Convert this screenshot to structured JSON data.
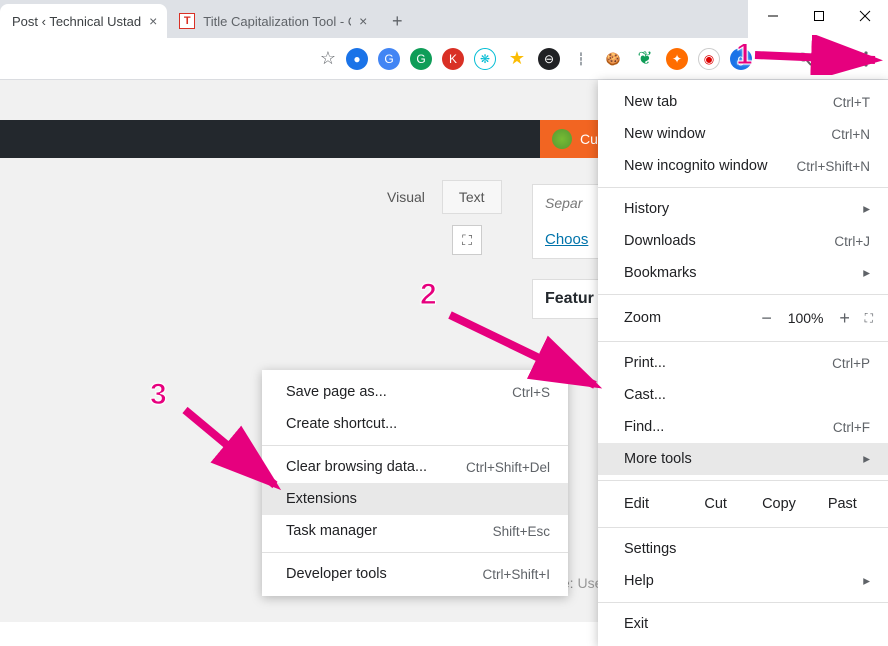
{
  "tabs": [
    {
      "title": "Post ‹ Technical Ustad",
      "favicon_letter": "",
      "favicon_bg": "#000"
    },
    {
      "title": "Title Capitalization Tool - Capitali",
      "favicon_letter": "T",
      "favicon_bg": "#fff"
    }
  ],
  "page": {
    "orange_button": "Cu",
    "editor_tab_visual": "Visual",
    "editor_tab_text": "Text",
    "separate_text": "Separ",
    "choose_link": "Choos",
    "featured_heading": "Featur",
    "notice_label": "Notice:",
    "notice_text": " Use only with those post templates:"
  },
  "chrome_menu": {
    "new_tab": {
      "label": "New tab",
      "shortcut": "Ctrl+T"
    },
    "new_window": {
      "label": "New window",
      "shortcut": "Ctrl+N"
    },
    "new_incognito": {
      "label": "New incognito window",
      "shortcut": "Ctrl+Shift+N"
    },
    "history": {
      "label": "History",
      "arrow": "▸"
    },
    "downloads": {
      "label": "Downloads",
      "shortcut": "Ctrl+J"
    },
    "bookmarks": {
      "label": "Bookmarks",
      "arrow": "▸"
    },
    "zoom": {
      "label": "Zoom",
      "value": "100%"
    },
    "print": {
      "label": "Print...",
      "shortcut": "Ctrl+P"
    },
    "cast": {
      "label": "Cast..."
    },
    "find": {
      "label": "Find...",
      "shortcut": "Ctrl+F"
    },
    "more_tools": {
      "label": "More tools",
      "arrow": "▸"
    },
    "edit": {
      "label": "Edit",
      "cut": "Cut",
      "copy": "Copy",
      "paste": "Past"
    },
    "settings": {
      "label": "Settings"
    },
    "help": {
      "label": "Help",
      "arrow": "▸"
    },
    "exit": {
      "label": "Exit"
    }
  },
  "submenu": {
    "save_page": {
      "label": "Save page as...",
      "shortcut": "Ctrl+S"
    },
    "create_shortcut": {
      "label": "Create shortcut..."
    },
    "clear_data": {
      "label": "Clear browsing data...",
      "shortcut": "Ctrl+Shift+Del"
    },
    "extensions": {
      "label": "Extensions"
    },
    "task_manager": {
      "label": "Task manager",
      "shortcut": "Shift+Esc"
    },
    "dev_tools": {
      "label": "Developer tools",
      "shortcut": "Ctrl+Shift+I"
    }
  },
  "badges": {
    "one": "1",
    "two": "2",
    "three": "3"
  },
  "ext_icons": [
    {
      "bg": "#1a73e8",
      "t": ""
    },
    {
      "bg": "#4285f4",
      "t": "G"
    },
    {
      "bg": "#0f9d58",
      "t": "G"
    },
    {
      "bg": "#d93025",
      "t": "K"
    },
    {
      "bg": "#00bcd4",
      "t": "❋"
    },
    {
      "bg": "#fbbc04",
      "t": "★"
    },
    {
      "bg": "#202124",
      "t": "●"
    },
    {
      "bg": "#9aa0a6",
      "t": "⋮"
    },
    {
      "bg": "#795548",
      "t": "🍪"
    },
    {
      "bg": "#0f9d58",
      "t": "▾"
    },
    {
      "bg": "#ff6d00",
      "t": "✦"
    },
    {
      "bg": "#fff",
      "t": "◉"
    },
    {
      "bg": "#1a73e8",
      "t": "g"
    },
    {
      "bg": "#fff",
      "t": ""
    },
    {
      "bg": "#202124",
      "t": "🔍"
    }
  ]
}
